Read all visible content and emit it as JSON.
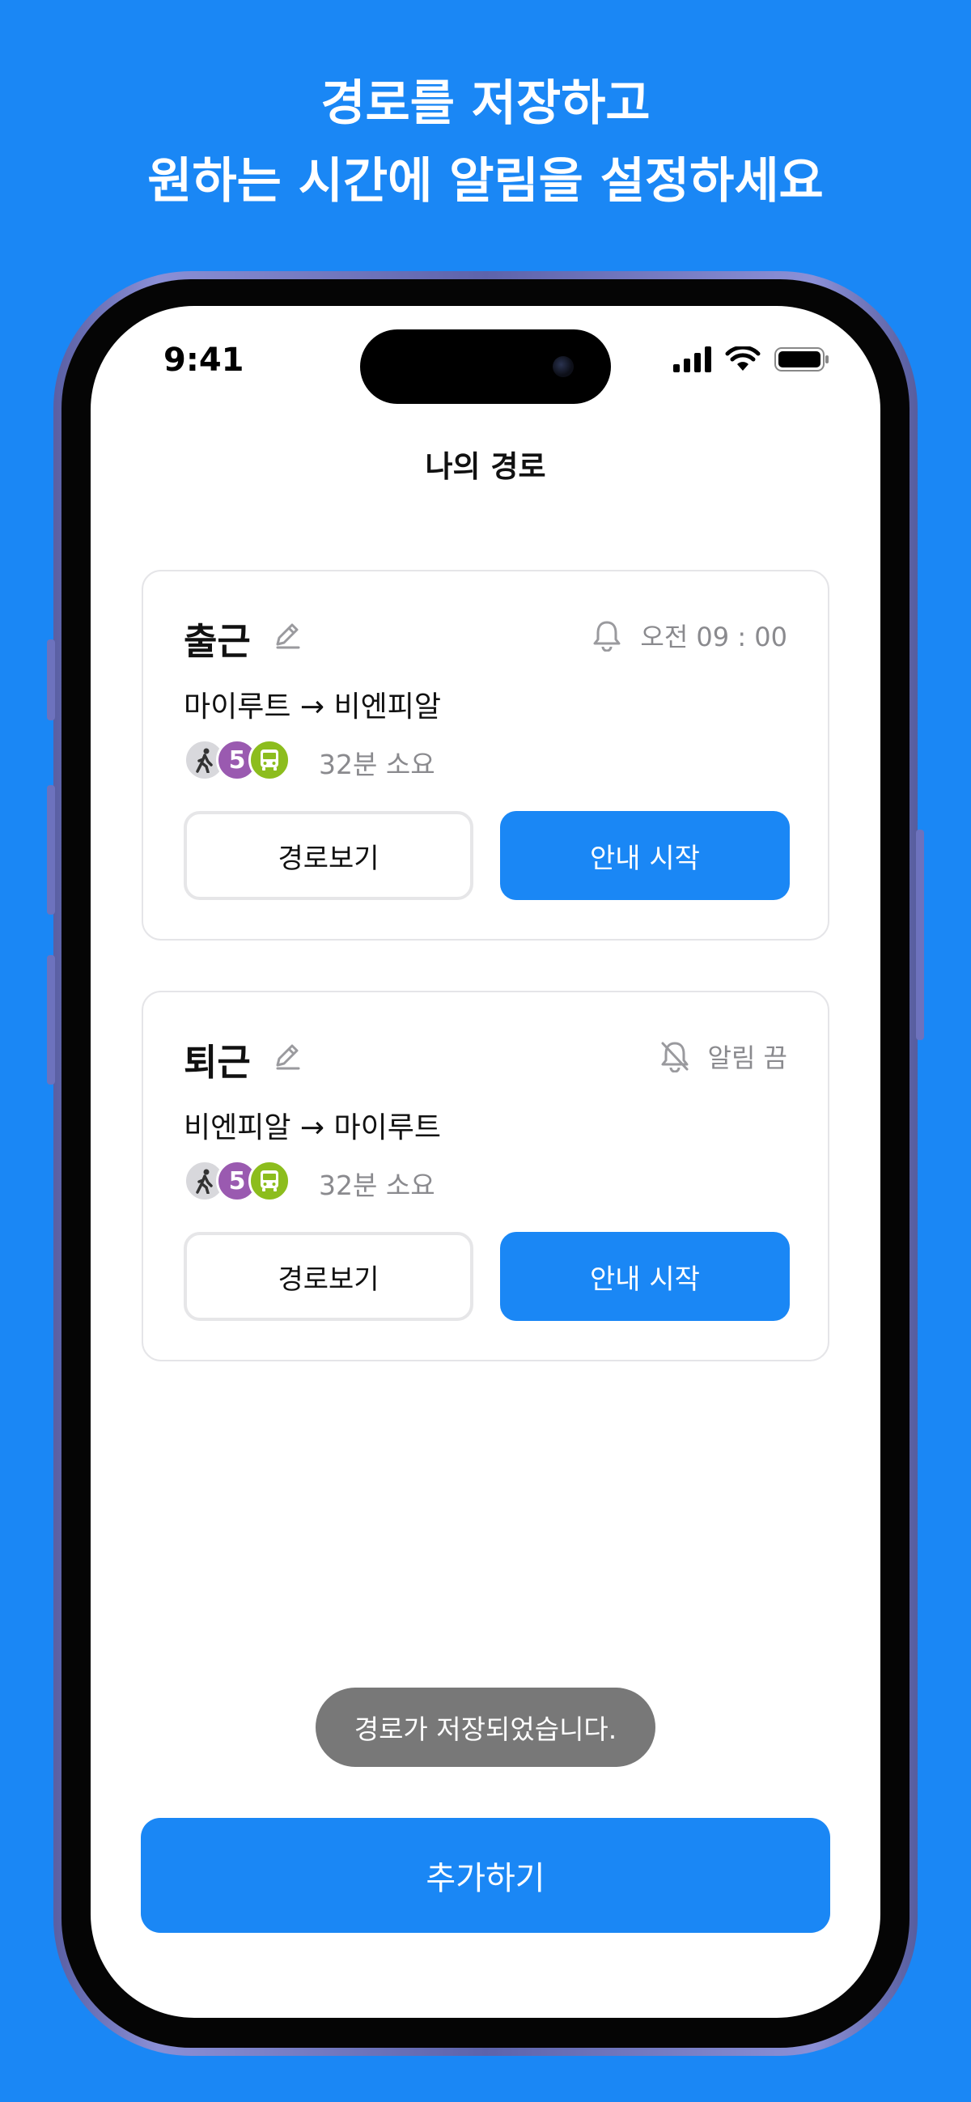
{
  "headline": {
    "line1": "경로를 저장하고",
    "line2": "원하는 시간에 알림을 설정하세요"
  },
  "status_bar": {
    "time": "9:41"
  },
  "screen_title": "나의 경로",
  "routes": [
    {
      "name": "출근",
      "alarm_text": "오전 09 : 00",
      "alarm_on": true,
      "route": "마이루트 → 비엔피알",
      "subway_line": "5",
      "duration": "32분 소요",
      "view_label": "경로보기",
      "start_label": "안내 시작"
    },
    {
      "name": "퇴근",
      "alarm_text": "알림 끔",
      "alarm_on": false,
      "route": "비엔피알 → 마이루트",
      "subway_line": "5",
      "duration": "32분 소요",
      "view_label": "경로보기",
      "start_label": "안내 시작"
    }
  ],
  "toast": "경로가 저장되었습니다.",
  "add_button": "추가하기",
  "colors": {
    "brand_blue": "#1a87f5",
    "subway_line_5": "#9a5ab0",
    "bus_green": "#8cbd1d",
    "muted_text": "#8a8a8e"
  },
  "icons": [
    "edit-pencil-icon",
    "bell-icon",
    "bell-off-icon",
    "walk-icon",
    "bus-icon",
    "cellular-signal-icon",
    "wifi-icon",
    "battery-icon"
  ]
}
